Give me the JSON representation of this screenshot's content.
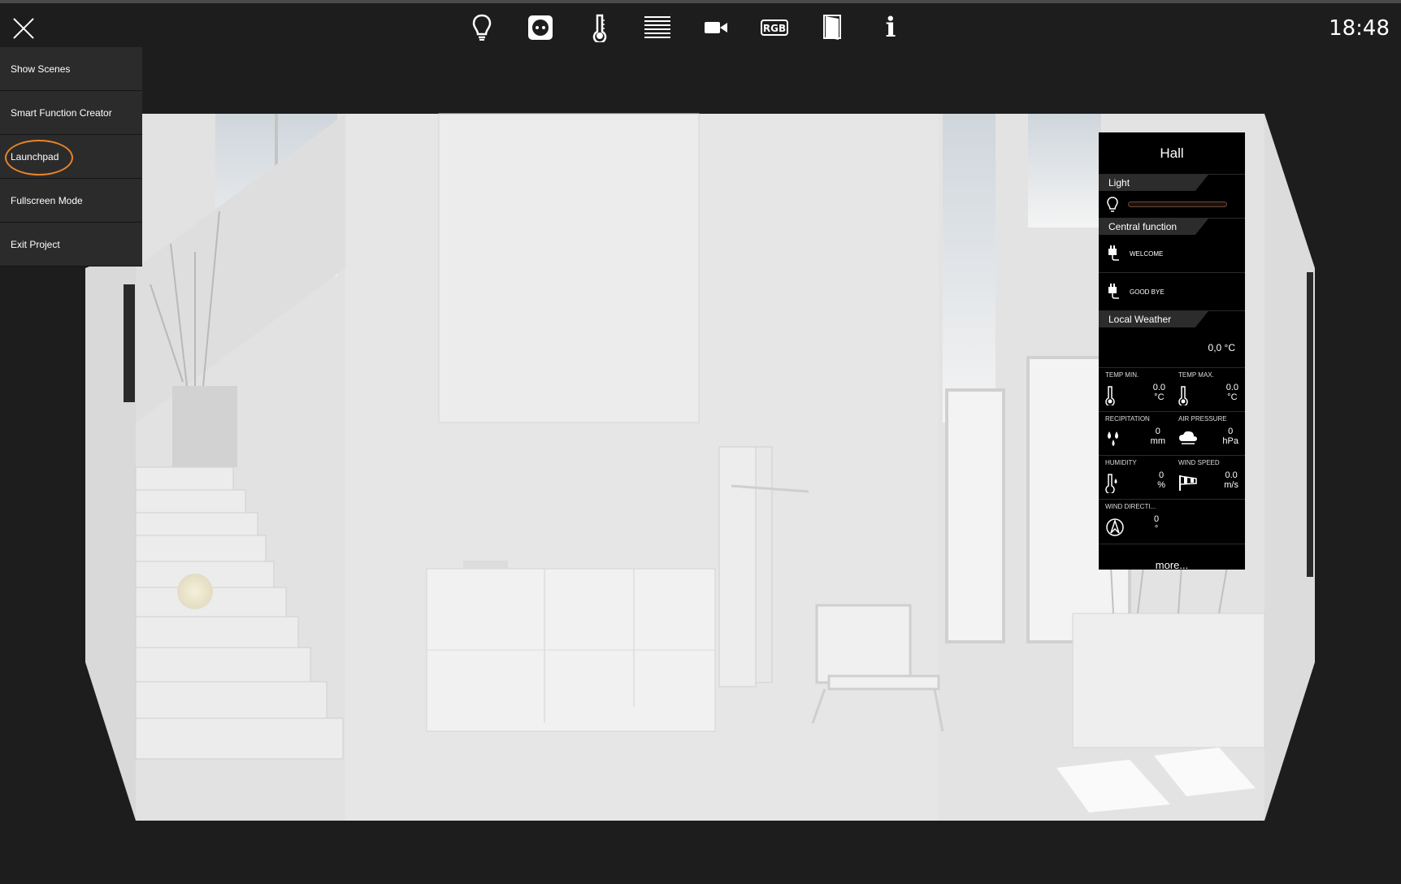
{
  "header": {
    "close_icon": "close-icon",
    "time": "18:48",
    "toolbar": [
      {
        "name": "light-bulb-icon"
      },
      {
        "name": "socket-icon"
      },
      {
        "name": "thermometer-icon"
      },
      {
        "name": "blinds-icon"
      },
      {
        "name": "camera-icon"
      },
      {
        "name": "rgb-icon",
        "label": "RGB"
      },
      {
        "name": "door-icon"
      },
      {
        "name": "info-icon",
        "label": "i"
      }
    ]
  },
  "menu": {
    "items": [
      {
        "label": "Show Scenes"
      },
      {
        "label": "Smart Function Creator"
      },
      {
        "label": "Launchpad",
        "highlighted": true
      },
      {
        "label": "Fullscreen Mode"
      },
      {
        "label": "Exit Project"
      }
    ],
    "highlight_color": "#e8832a"
  },
  "room_panel": {
    "title": "Hall",
    "light_section": "Light",
    "central_section": "Central function",
    "welcome": "WELCOME",
    "goodbye": "GOOD BYE",
    "weather_section": "Local Weather",
    "current_temp": "0,0 °C",
    "weather": {
      "temp_min": {
        "label": "TEMP MIN.",
        "value": "0.0",
        "unit": "°C"
      },
      "temp_max": {
        "label": "TEMP MAX.",
        "value": "0.0",
        "unit": "°C"
      },
      "precipitation": {
        "label": "RECIPITATION",
        "value": "0",
        "unit": "mm"
      },
      "air_pressure": {
        "label": "AIR PRESSURE",
        "value": "0",
        "unit": "hPa"
      },
      "humidity": {
        "label": "HUMIDITY",
        "value": "0",
        "unit": "%"
      },
      "wind_speed": {
        "label": "WIND SPEED",
        "value": "0.0",
        "unit": "m/s"
      },
      "wind_direction": {
        "label": "WIND DIRECTI...",
        "value": "0",
        "unit": "°"
      }
    },
    "more": "more..."
  }
}
